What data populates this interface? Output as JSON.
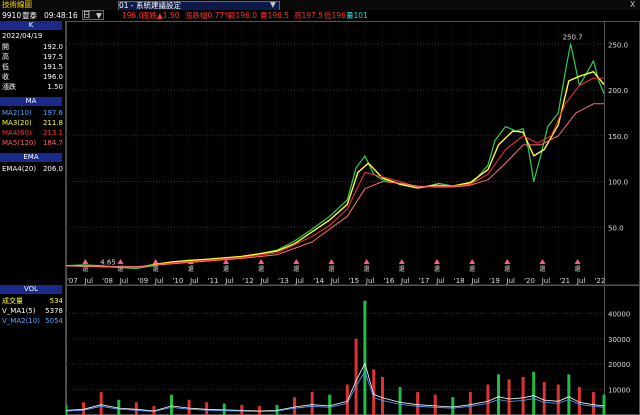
{
  "window": {
    "title": "技術線圖",
    "tab": "01 - 系統建議設定",
    "close": "X",
    "dropdown_arrow": "▼"
  },
  "header": {
    "code": "9910",
    "name": "豐泰",
    "time": "09:48:16",
    "interval": "日",
    "fields": [
      {
        "label": "",
        "value": "196.0",
        "color": "#ff3030"
      },
      {
        "label": "漲跌",
        "value": "▲1.50",
        "color": "#ff3030"
      },
      {
        "label": "漲跌幅",
        "value": "0.77%",
        "color": "#ff3030"
      },
      {
        "label": "買",
        "value": "196.0",
        "color": "#ff3030"
      },
      {
        "label": "賣",
        "value": "196.5",
        "color": "#ff3030"
      },
      {
        "label": "高",
        "value": "197.5",
        "color": "#ff3030"
      },
      {
        "label": "低",
        "value": "196.0",
        "color": "#ff3030"
      },
      {
        "label": "量",
        "value": "101",
        "color": "#00e0e0"
      }
    ]
  },
  "k_panel": {
    "title": "K",
    "date": "2022/04/19",
    "rows": [
      {
        "label": "開",
        "value": "192.0"
      },
      {
        "label": "高",
        "value": "197.5"
      },
      {
        "label": "低",
        "value": "191.5"
      },
      {
        "label": "收",
        "value": "196.0"
      },
      {
        "label": "漲跌",
        "value": "1.50"
      }
    ]
  },
  "ma_panel": {
    "title": "MA",
    "rows": [
      {
        "label": "MA2(10)",
        "value": "197.6",
        "color": "#4da6ff"
      },
      {
        "label": "MA3(20)",
        "value": "211.8",
        "color": "#ffff30"
      },
      {
        "label": "MA4(60)",
        "value": "213.1",
        "color": "#ff3030"
      },
      {
        "label": "MA5(120)",
        "value": "184.7",
        "color": "#ff6060"
      }
    ]
  },
  "ema_panel": {
    "title": "EMA",
    "rows": [
      {
        "label": "EMA4(20)",
        "value": "206.0",
        "color": "#ffffff"
      }
    ]
  },
  "vol_panel": {
    "title": "VOL",
    "rows": [
      {
        "label": "成交量",
        "value": "534",
        "color": "#ffff30"
      },
      {
        "label": "V_MA1(5)",
        "value": "5378",
        "color": "#ffffff"
      },
      {
        "label": "V_MA2(10)",
        "value": "5054",
        "color": "#4da6ff"
      }
    ]
  },
  "chart_data": [
    {
      "type": "line",
      "panel": "price",
      "y_ticks": [
        "250.0",
        "200.0",
        "150.0",
        "100.0",
        "50.0"
      ],
      "ylim": [
        0,
        270
      ],
      "x_tick_labels": [
        "'07",
        "Jul",
        "'08",
        "Jul",
        "'09",
        "Jul",
        "'10",
        "Jul",
        "'11",
        "Jul",
        "'12",
        "Jul",
        "'13",
        "Jul",
        "'14",
        "Jul",
        "'15",
        "Jul",
        "'16",
        "Jul",
        "'17",
        "Jul",
        "'18",
        "Jul",
        "'19",
        "Jul",
        "'20",
        "Jul",
        "'21",
        "Jul",
        "'22"
      ],
      "annotations": [
        {
          "text": "250.7",
          "x": 2021.35,
          "y": 250.7
        },
        {
          "text": "4.65",
          "x": 2008.2,
          "y": 4.65
        }
      ],
      "ex_dividend_marker": "還",
      "ex_dividend_years": [
        2007.55,
        2008.55,
        2009.55,
        2010.55,
        2011.55,
        2012.55,
        2013.55,
        2014.55,
        2015.55,
        2016.55,
        2017.55,
        2018.55,
        2019.55,
        2020.55,
        2021.55
      ],
      "series": [
        {
          "name": "K",
          "color": "#33cc55",
          "x": [
            2007.0,
            2007.5,
            2008.0,
            2008.5,
            2009.0,
            2009.5,
            2010.0,
            2010.5,
            2011.0,
            2011.5,
            2012.0,
            2012.5,
            2013.0,
            2013.5,
            2014.0,
            2014.5,
            2015.0,
            2015.25,
            2015.5,
            2015.75,
            2016.0,
            2016.3,
            2016.6,
            2017.0,
            2017.3,
            2017.6,
            2018.0,
            2018.3,
            2018.6,
            2019.0,
            2019.2,
            2019.5,
            2019.8,
            2020.0,
            2020.15,
            2020.3,
            2020.5,
            2020.7,
            2021.0,
            2021.2,
            2021.35,
            2021.6,
            2021.8,
            2022.0,
            2022.15,
            2022.3
          ],
          "y": [
            8,
            9,
            8,
            6,
            5,
            8,
            12,
            14,
            15,
            16,
            18,
            21,
            25,
            35,
            48,
            62,
            80,
            115,
            128,
            108,
            102,
            100,
            96,
            93,
            95,
            98,
            95,
            96,
            100,
            118,
            145,
            160,
            155,
            158,
            136,
            100,
            128,
            160,
            175,
            220,
            250.7,
            205,
            218,
            232,
            210,
            196
          ]
        },
        {
          "name": "MA3(20)",
          "color": "#ffff30",
          "x": [
            2007.0,
            2008.0,
            2009.0,
            2010.0,
            2011.0,
            2012.0,
            2013.0,
            2013.5,
            2014.0,
            2014.5,
            2015.0,
            2015.3,
            2015.6,
            2016.0,
            2016.5,
            2017.0,
            2017.5,
            2018.0,
            2018.5,
            2019.0,
            2019.3,
            2019.7,
            2020.0,
            2020.3,
            2020.6,
            2021.0,
            2021.3,
            2021.6,
            2022.0,
            2022.3
          ],
          "y": [
            8,
            7,
            6,
            12,
            15,
            18,
            24,
            32,
            45,
            58,
            75,
            110,
            120,
            104,
            97,
            93,
            96,
            95,
            99,
            113,
            140,
            155,
            154,
            128,
            135,
            162,
            210,
            215,
            220,
            206
          ]
        },
        {
          "name": "MA4(60)",
          "color": "#ff3030",
          "x": [
            2007.0,
            2008.0,
            2009.0,
            2010.0,
            2011.0,
            2012.0,
            2013.0,
            2014.0,
            2014.5,
            2015.0,
            2015.5,
            2016.0,
            2016.5,
            2017.0,
            2017.5,
            2018.0,
            2018.5,
            2019.0,
            2019.5,
            2020.0,
            2020.4,
            2020.8,
            2021.2,
            2021.6,
            2022.0,
            2022.3
          ],
          "y": [
            8,
            7,
            6,
            11,
            14,
            17,
            22,
            40,
            52,
            70,
            110,
            105,
            100,
            94,
            95,
            95,
            97,
            108,
            135,
            150,
            142,
            150,
            185,
            205,
            213,
            213
          ]
        },
        {
          "name": "MA5(120)",
          "color": "#ff7070",
          "x": [
            2007.0,
            2008.0,
            2009.0,
            2010.0,
            2011.0,
            2012.0,
            2013.0,
            2014.0,
            2015.0,
            2015.5,
            2016.0,
            2016.5,
            2017.0,
            2017.5,
            2018.0,
            2018.5,
            2019.0,
            2019.5,
            2020.0,
            2020.5,
            2021.0,
            2021.5,
            2022.0,
            2022.3
          ],
          "y": [
            8,
            7,
            7,
            10,
            13,
            16,
            20,
            34,
            62,
            92,
            100,
            98,
            95,
            94,
            94,
            96,
            102,
            120,
            140,
            140,
            150,
            175,
            185,
            185
          ]
        }
      ]
    },
    {
      "type": "bar",
      "panel": "volume",
      "y_ticks": [
        "40000",
        "30000",
        "20000",
        "10000"
      ],
      "ylim": [
        0,
        48000
      ],
      "x_range": [
        2007.0,
        2022.3
      ],
      "bars_x": [
        2007.0,
        2007.5,
        2008.0,
        2008.5,
        2009.0,
        2009.5,
        2010.0,
        2010.5,
        2011.0,
        2011.5,
        2012.0,
        2012.5,
        2013.0,
        2013.5,
        2014.0,
        2014.5,
        2015.0,
        2015.25,
        2015.5,
        2015.75,
        2016.0,
        2016.5,
        2017.0,
        2017.5,
        2018.0,
        2018.5,
        2019.0,
        2019.3,
        2019.6,
        2020.0,
        2020.3,
        2020.6,
        2021.0,
        2021.3,
        2021.6,
        2022.0,
        2022.3
      ],
      "values": [
        4000,
        5000,
        9000,
        6000,
        5000,
        3500,
        8000,
        6000,
        5000,
        4500,
        4000,
        3500,
        4000,
        7000,
        9000,
        8000,
        12000,
        30000,
        45000,
        18000,
        15000,
        11000,
        9000,
        8000,
        7000,
        9000,
        12000,
        16000,
        14000,
        15000,
        17000,
        13000,
        12000,
        16000,
        11000,
        9000,
        8000
      ],
      "series": [
        {
          "name": "V_MA1(5)",
          "color": "#ffffff"
        },
        {
          "name": "V_MA2(10)",
          "color": "#4da6ff"
        }
      ]
    }
  ]
}
